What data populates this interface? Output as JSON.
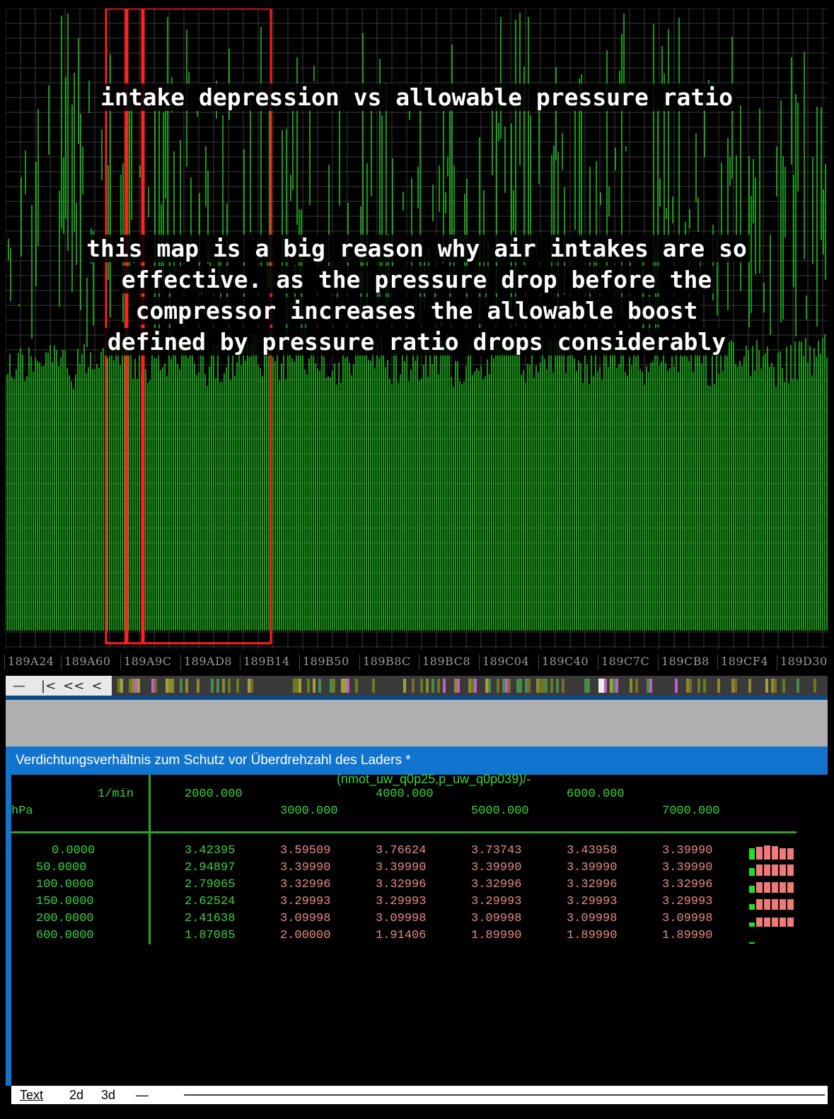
{
  "hex_view": {
    "title_caption": "intake depression vs allowable pressure ratio",
    "note_caption_lines": [
      "this map is a big reason why air intakes are so",
      "effective. as the pressure drop before the",
      "compressor increases the allowable boost",
      "defined by pressure ratio drops considerably"
    ],
    "trace_color": "#22c822",
    "highlight_color": "#ff2020"
  },
  "addresses": [
    "189A24",
    "189A60",
    "189A9C",
    "189AD8",
    "189B14",
    "189B50",
    "189B8C",
    "189BC8",
    "189C04",
    "189C40",
    "189C7C",
    "189CB8",
    "189CF4",
    "189D30"
  ],
  "nav": {
    "btn1": "—",
    "btn2": "|<",
    "btn3": "<<",
    "btn4": "<"
  },
  "map": {
    "title": "Verdichtungsverhältnis zum Schutz vor Überdrehzahl des Laders *",
    "axis_formula": "(nmot_uw_q0p25,p_uw_q0p039)/-",
    "x_unit": "1/min",
    "y_unit": "hPa",
    "x_axis_top": [
      "2000.000",
      "4000.000",
      "6000.000"
    ],
    "x_axis_bottom": [
      "3000.000",
      "5000.000",
      "7000.000"
    ],
    "rows": [
      {
        "y": "0.0000",
        "values": [
          "3.42395",
          "3.59509",
          "3.76624",
          "3.73743",
          "3.43958",
          "3.39990"
        ]
      },
      {
        "y": "50.0000",
        "values": [
          "2.94897",
          "3.39990",
          "3.39990",
          "3.39990",
          "3.39990",
          "3.39990"
        ]
      },
      {
        "y": "100.0000",
        "values": [
          "2.79065",
          "3.32996",
          "3.32996",
          "3.32996",
          "3.32996",
          "3.32996"
        ]
      },
      {
        "y": "150.0000",
        "values": [
          "2.62524",
          "3.29993",
          "3.29993",
          "3.29993",
          "3.29993",
          "3.29993"
        ]
      },
      {
        "y": "200.0000",
        "values": [
          "2.41638",
          "3.09998",
          "3.09998",
          "3.09998",
          "3.09998",
          "3.09998"
        ]
      },
      {
        "y": "600.0000",
        "values": [
          "1.87085",
          "2.00000",
          "1.91406",
          "1.89990",
          "1.89990",
          "1.89990"
        ]
      }
    ],
    "colors": {
      "axis": "#3dd23d",
      "value": "#e88a8a",
      "header": "#1175d0"
    }
  },
  "tabs": {
    "text": "Text",
    "twod": "2d",
    "threed": "3d",
    "dash": "—"
  }
}
